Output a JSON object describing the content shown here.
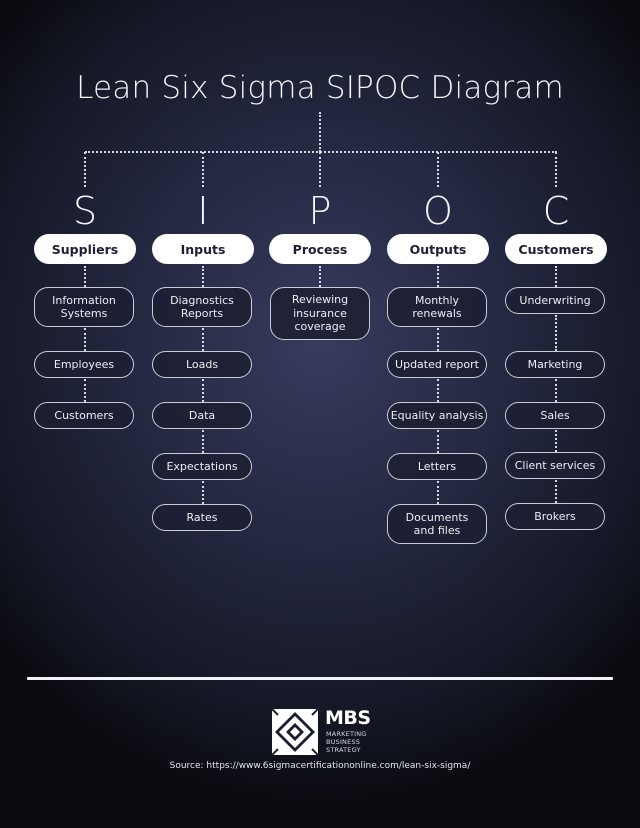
{
  "title": "Lean Six Sigma SIPOC Diagram",
  "columns": [
    {
      "letter": "S",
      "header": "Suppliers",
      "items": [
        "Information Systems",
        "Employees",
        "Customers"
      ]
    },
    {
      "letter": "I",
      "header": "Inputs",
      "items": [
        "Diagnostics Reports",
        "Loads",
        "Data",
        "Expectations",
        "Rates"
      ]
    },
    {
      "letter": "P",
      "header": "Process",
      "items": [
        "Reviewing insurance coverage"
      ]
    },
    {
      "letter": "O",
      "header": "Outputs",
      "items": [
        "Monthly renewals",
        "Updated report",
        "Equality analysis",
        "Letters",
        "Documents and files"
      ]
    },
    {
      "letter": "C",
      "header": "Customers",
      "items": [
        "Underwriting",
        "Marketing",
        "Sales",
        "Client services",
        "Brokers"
      ]
    }
  ],
  "footer": {
    "logo_icon": "mbs-diamond-logo-icon",
    "brand": "MBS",
    "tagline": [
      "MARKETING",
      "BUSINESS",
      "STRATEGY"
    ],
    "source": "Source: https://www.6sigmacertificationonline.com/lean-six-sigma/"
  },
  "colors": {
    "background": "#1b1e30",
    "header_fill": "#ffffff",
    "header_text": "#1d2033",
    "item_border": "#c9ccd8",
    "connector": "#d7d9e3"
  }
}
